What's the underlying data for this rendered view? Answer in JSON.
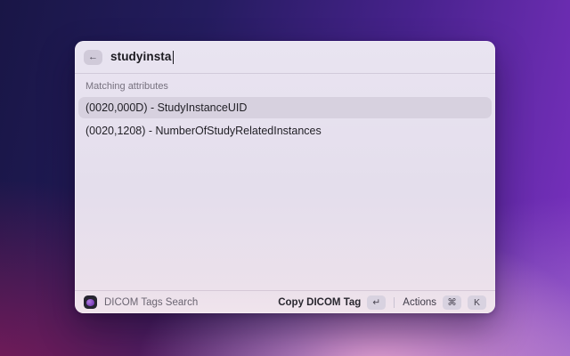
{
  "window": {
    "search": {
      "value": "studyinsta",
      "back_icon": "←"
    },
    "section_header": "Matching attributes",
    "results": [
      {
        "label": "(0020,000D) - StudyInstanceUID",
        "selected": true
      },
      {
        "label": "(0020,1208) - NumberOfStudyRelatedInstances",
        "selected": false
      }
    ],
    "footer": {
      "app_name": "DICOM Tags Search",
      "primary_action_label": "Copy DICOM Tag",
      "primary_action_key": "↵",
      "actions_label": "Actions",
      "actions_key_1": "⌘",
      "actions_key_2": "K"
    }
  },
  "colors": {
    "window_bg": "#e6e0ed",
    "selected_row_bg": "#d7d1df",
    "key_badge_bg": "#d8d2e0",
    "wallpaper_top_left": "#191646",
    "wallpaper_top_right": "#7b31c1",
    "wallpaper_bottom_left": "#8b1c5c",
    "wallpaper_bottom_glow": "#e8a6d3"
  }
}
